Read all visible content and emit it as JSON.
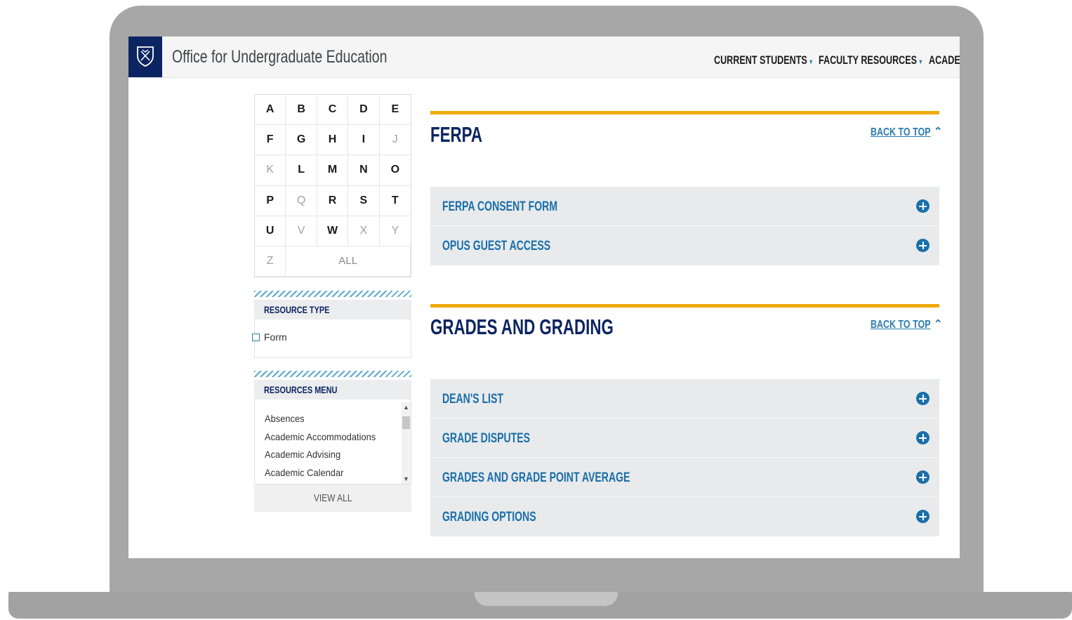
{
  "header": {
    "site_title": "Office for Undergraduate Education",
    "nav": [
      {
        "label": "CURRENT STUDENTS",
        "caret": "▾"
      },
      {
        "label": "FACULTY RESOURCES",
        "caret": "▾"
      },
      {
        "label": "ACADE",
        "caret": ""
      }
    ]
  },
  "alphabet": {
    "letters": [
      {
        "l": "A",
        "enabled": true
      },
      {
        "l": "B",
        "enabled": true
      },
      {
        "l": "C",
        "enabled": true
      },
      {
        "l": "D",
        "enabled": true
      },
      {
        "l": "E",
        "enabled": true
      },
      {
        "l": "F",
        "enabled": true
      },
      {
        "l": "G",
        "enabled": true
      },
      {
        "l": "H",
        "enabled": true
      },
      {
        "l": "I",
        "enabled": true
      },
      {
        "l": "J",
        "enabled": false
      },
      {
        "l": "K",
        "enabled": false
      },
      {
        "l": "L",
        "enabled": true
      },
      {
        "l": "M",
        "enabled": true
      },
      {
        "l": "N",
        "enabled": true
      },
      {
        "l": "O",
        "enabled": true
      },
      {
        "l": "P",
        "enabled": true
      },
      {
        "l": "Q",
        "enabled": false
      },
      {
        "l": "R",
        "enabled": true
      },
      {
        "l": "S",
        "enabled": true
      },
      {
        "l": "T",
        "enabled": true
      },
      {
        "l": "U",
        "enabled": true
      },
      {
        "l": "V",
        "enabled": false
      },
      {
        "l": "W",
        "enabled": true
      },
      {
        "l": "X",
        "enabled": false
      },
      {
        "l": "Y",
        "enabled": false
      },
      {
        "l": "Z",
        "enabled": false
      }
    ],
    "all_label": "ALL"
  },
  "resource_type": {
    "heading": "RESOURCE TYPE",
    "options": [
      {
        "label": "Form",
        "checked": false
      }
    ]
  },
  "resources_menu": {
    "heading": "RESOURCES MENU",
    "items": [
      "Absences",
      "Academic Accommodations",
      "Academic Advising",
      "Academic Calendar"
    ],
    "view_all_label": "VIEW ALL"
  },
  "sections": [
    {
      "title": "FERPA",
      "back_to_top": "BACK TO TOP",
      "items": [
        "FERPA CONSENT FORM",
        "OPUS GUEST ACCESS"
      ]
    },
    {
      "title": "GRADES AND GRADING",
      "back_to_top": "BACK TO TOP",
      "items": [
        "DEAN'S LIST",
        "GRADE DISPUTES",
        "GRADES AND GRADE POINT AVERAGE",
        "GRADING OPTIONS"
      ]
    }
  ],
  "colors": {
    "navy": "#0c2461",
    "accent_blue": "#1a6fa8",
    "gold": "#f0aa0c",
    "panel_gray": "#e8eaec"
  }
}
